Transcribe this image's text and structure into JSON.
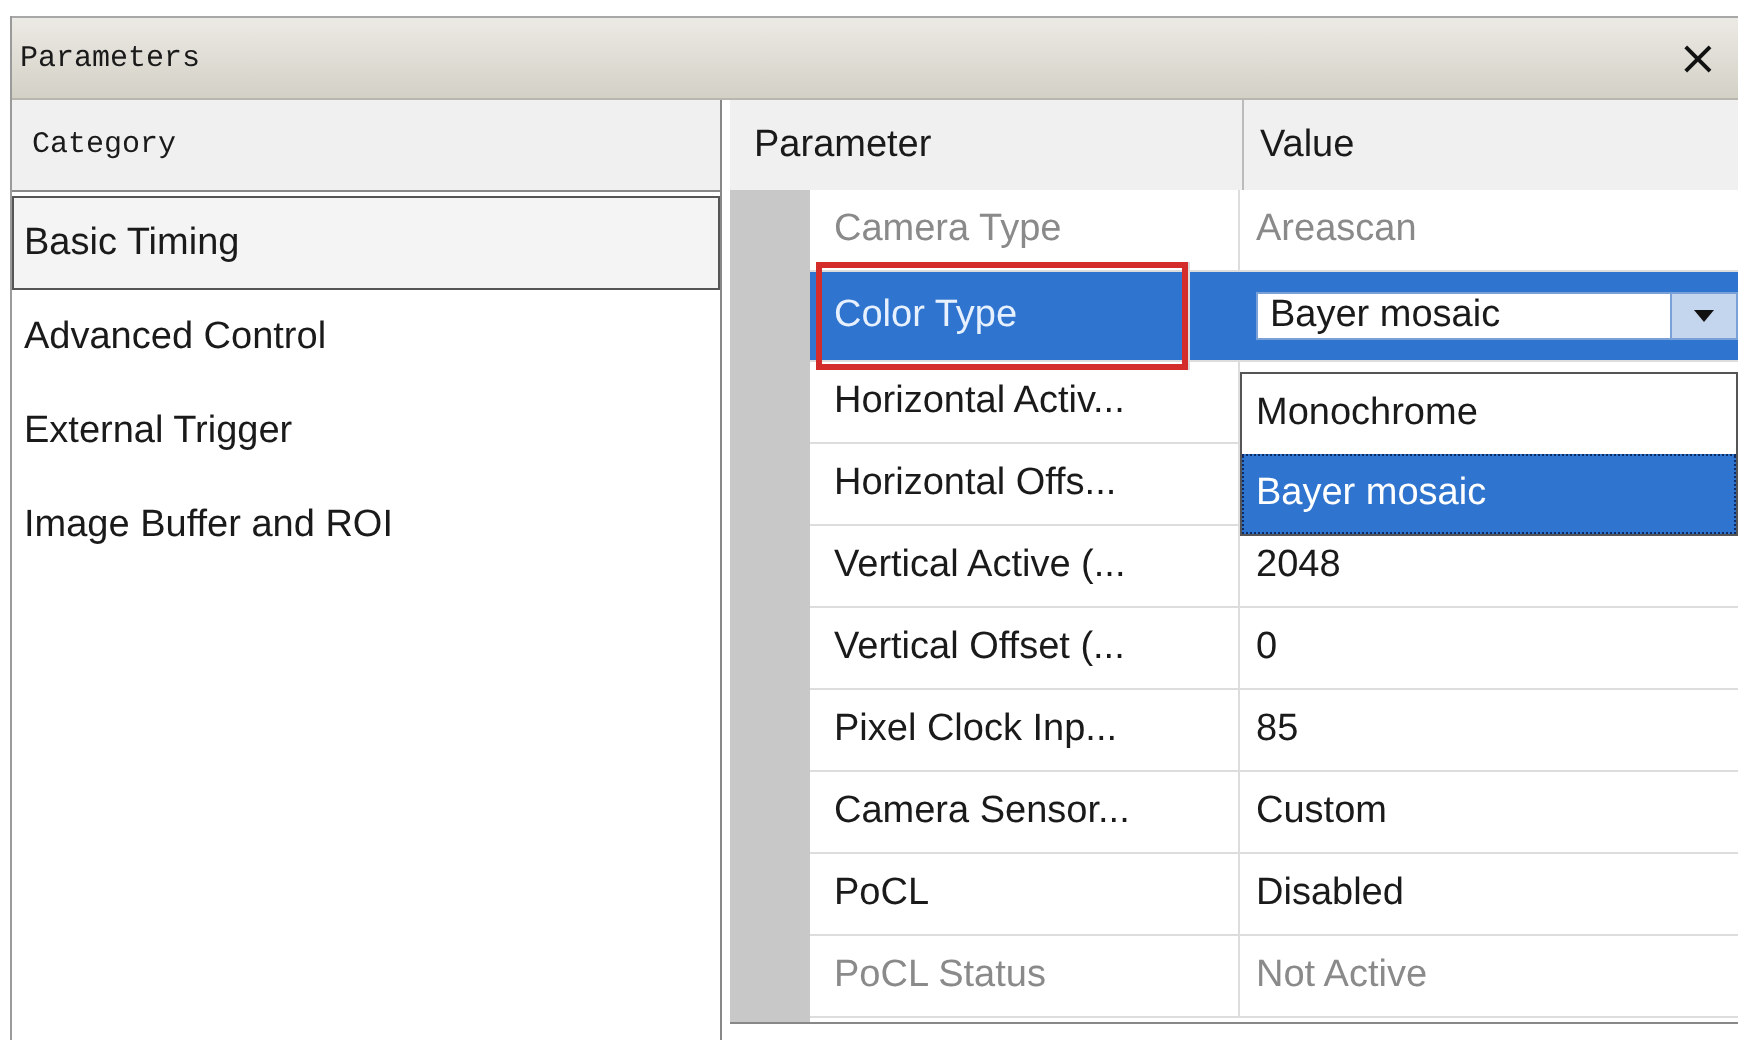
{
  "window": {
    "title": "Parameters",
    "close": "×"
  },
  "category_header": "Category",
  "categories": [
    {
      "label": "Basic Timing",
      "selected": true
    },
    {
      "label": "Advanced Control",
      "selected": false
    },
    {
      "label": "External Trigger",
      "selected": false
    },
    {
      "label": "Image Buffer and ROI",
      "selected": false
    }
  ],
  "columns": [
    "Parameter",
    "Value"
  ],
  "rows": [
    {
      "kind": "text",
      "name": "Camera Type",
      "value": "Areascan",
      "disabled": true,
      "selected": false,
      "highlighted": false
    },
    {
      "kind": "combo",
      "name": "Color Type",
      "value": "Bayer mosaic",
      "disabled": false,
      "selected": true,
      "highlighted": true,
      "options": [
        {
          "label": "Monochrome",
          "selected": false
        },
        {
          "label": "Bayer mosaic",
          "selected": true
        }
      ]
    },
    {
      "kind": "covered",
      "name": "Horizontal Activ...",
      "disabled": false,
      "selected": false,
      "highlighted": false
    },
    {
      "kind": "covered",
      "name": "Horizontal Offs...",
      "disabled": false,
      "selected": false,
      "highlighted": false
    },
    {
      "kind": "text",
      "name": "Vertical Active (...",
      "value": "2048",
      "disabled": false,
      "selected": false,
      "highlighted": false
    },
    {
      "kind": "text",
      "name": "Vertical Offset (...",
      "value": "0",
      "disabled": false,
      "selected": false,
      "highlighted": false
    },
    {
      "kind": "text",
      "name": "Pixel Clock Inp...",
      "value": "85",
      "disabled": false,
      "selected": false,
      "highlighted": false
    },
    {
      "kind": "text",
      "name": "Camera Sensor...",
      "value": "Custom",
      "disabled": false,
      "selected": false,
      "highlighted": false
    },
    {
      "kind": "text",
      "name": "PoCL",
      "value": "Disabled",
      "disabled": false,
      "selected": false,
      "highlighted": false
    },
    {
      "kind": "text",
      "name": "PoCL Status",
      "value": "Not Active",
      "disabled": true,
      "selected": false,
      "highlighted": false
    }
  ]
}
